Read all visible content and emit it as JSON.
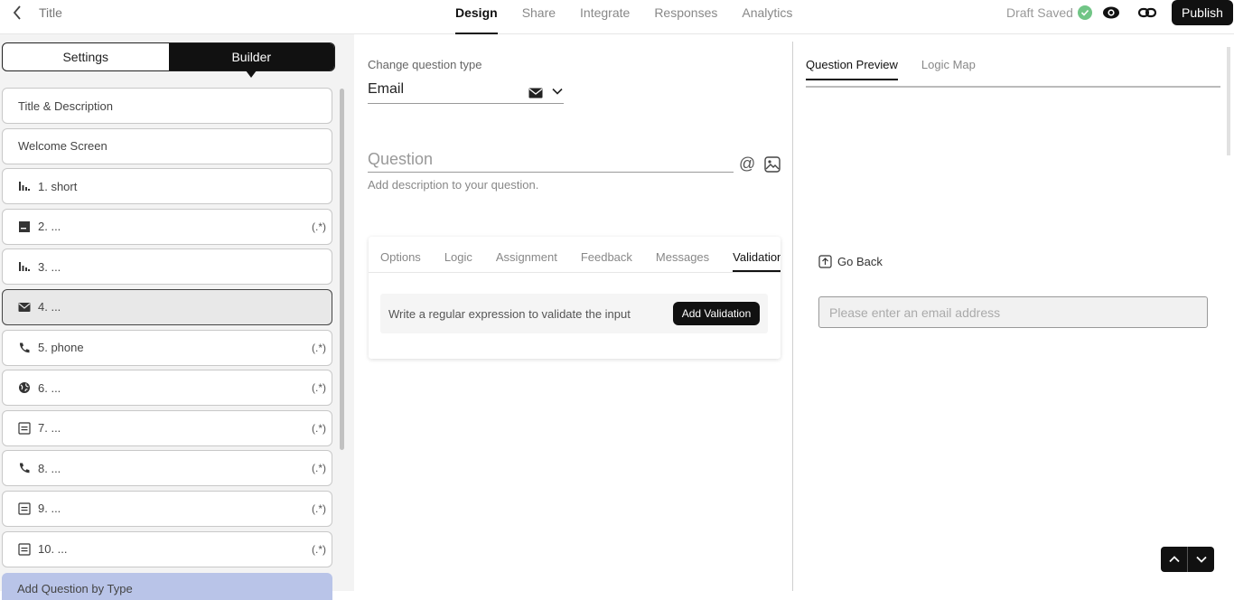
{
  "header": {
    "title": "Title",
    "tabs": [
      "Design",
      "Share",
      "Integrate",
      "Responses",
      "Analytics"
    ],
    "active_tab": "Design",
    "draft_status": "Draft Saved",
    "publish_label": "Publish"
  },
  "sidebar": {
    "settings_label": "Settings",
    "builder_label": "Builder",
    "items": [
      {
        "label": "Title & Description",
        "icon": "",
        "regex": ""
      },
      {
        "label": "Welcome Screen",
        "icon": "",
        "regex": ""
      },
      {
        "label": "1. short",
        "icon": "short-text-icon",
        "regex": ""
      },
      {
        "label": "2. ...",
        "icon": "long-text-icon",
        "regex": "(.*)"
      },
      {
        "label": "3. ...",
        "icon": "short-text-icon",
        "regex": ""
      },
      {
        "label": "4. ...",
        "icon": "envelope-icon",
        "regex": "",
        "selected": true
      },
      {
        "label": "5. phone",
        "icon": "phone-icon",
        "regex": "(.*)"
      },
      {
        "label": "6. ...",
        "icon": "globe-icon",
        "regex": "(.*)"
      },
      {
        "label": "7. ...",
        "icon": "list-icon",
        "regex": "(.*)"
      },
      {
        "label": "8. ...",
        "icon": "phone-icon",
        "regex": "(.*)"
      },
      {
        "label": "9. ...",
        "icon": "list-icon",
        "regex": "(.*)"
      },
      {
        "label": "10. ...",
        "icon": "list-icon",
        "regex": "(.*)"
      }
    ],
    "add_question_label": "Add Question by Type"
  },
  "editor": {
    "change_type_label": "Change question type",
    "question_type": "Email",
    "question_placeholder": "Question",
    "description_placeholder": "Add description to your question.",
    "tabs": [
      "Options",
      "Logic",
      "Assignment",
      "Feedback",
      "Messages",
      "Validation"
    ],
    "active_tab": "Validation",
    "validation_text": "Write a regular expression to validate the input",
    "add_validation_label": "Add Validation"
  },
  "preview": {
    "tabs": [
      "Question Preview",
      "Logic Map"
    ],
    "active_tab": "Question Preview",
    "go_back_label": "Go Back",
    "email_placeholder": "Please enter an email address"
  },
  "colors": {
    "accent": "#111111",
    "draft_check": "#71c586",
    "add_question_bg": "#b9c4e8"
  }
}
